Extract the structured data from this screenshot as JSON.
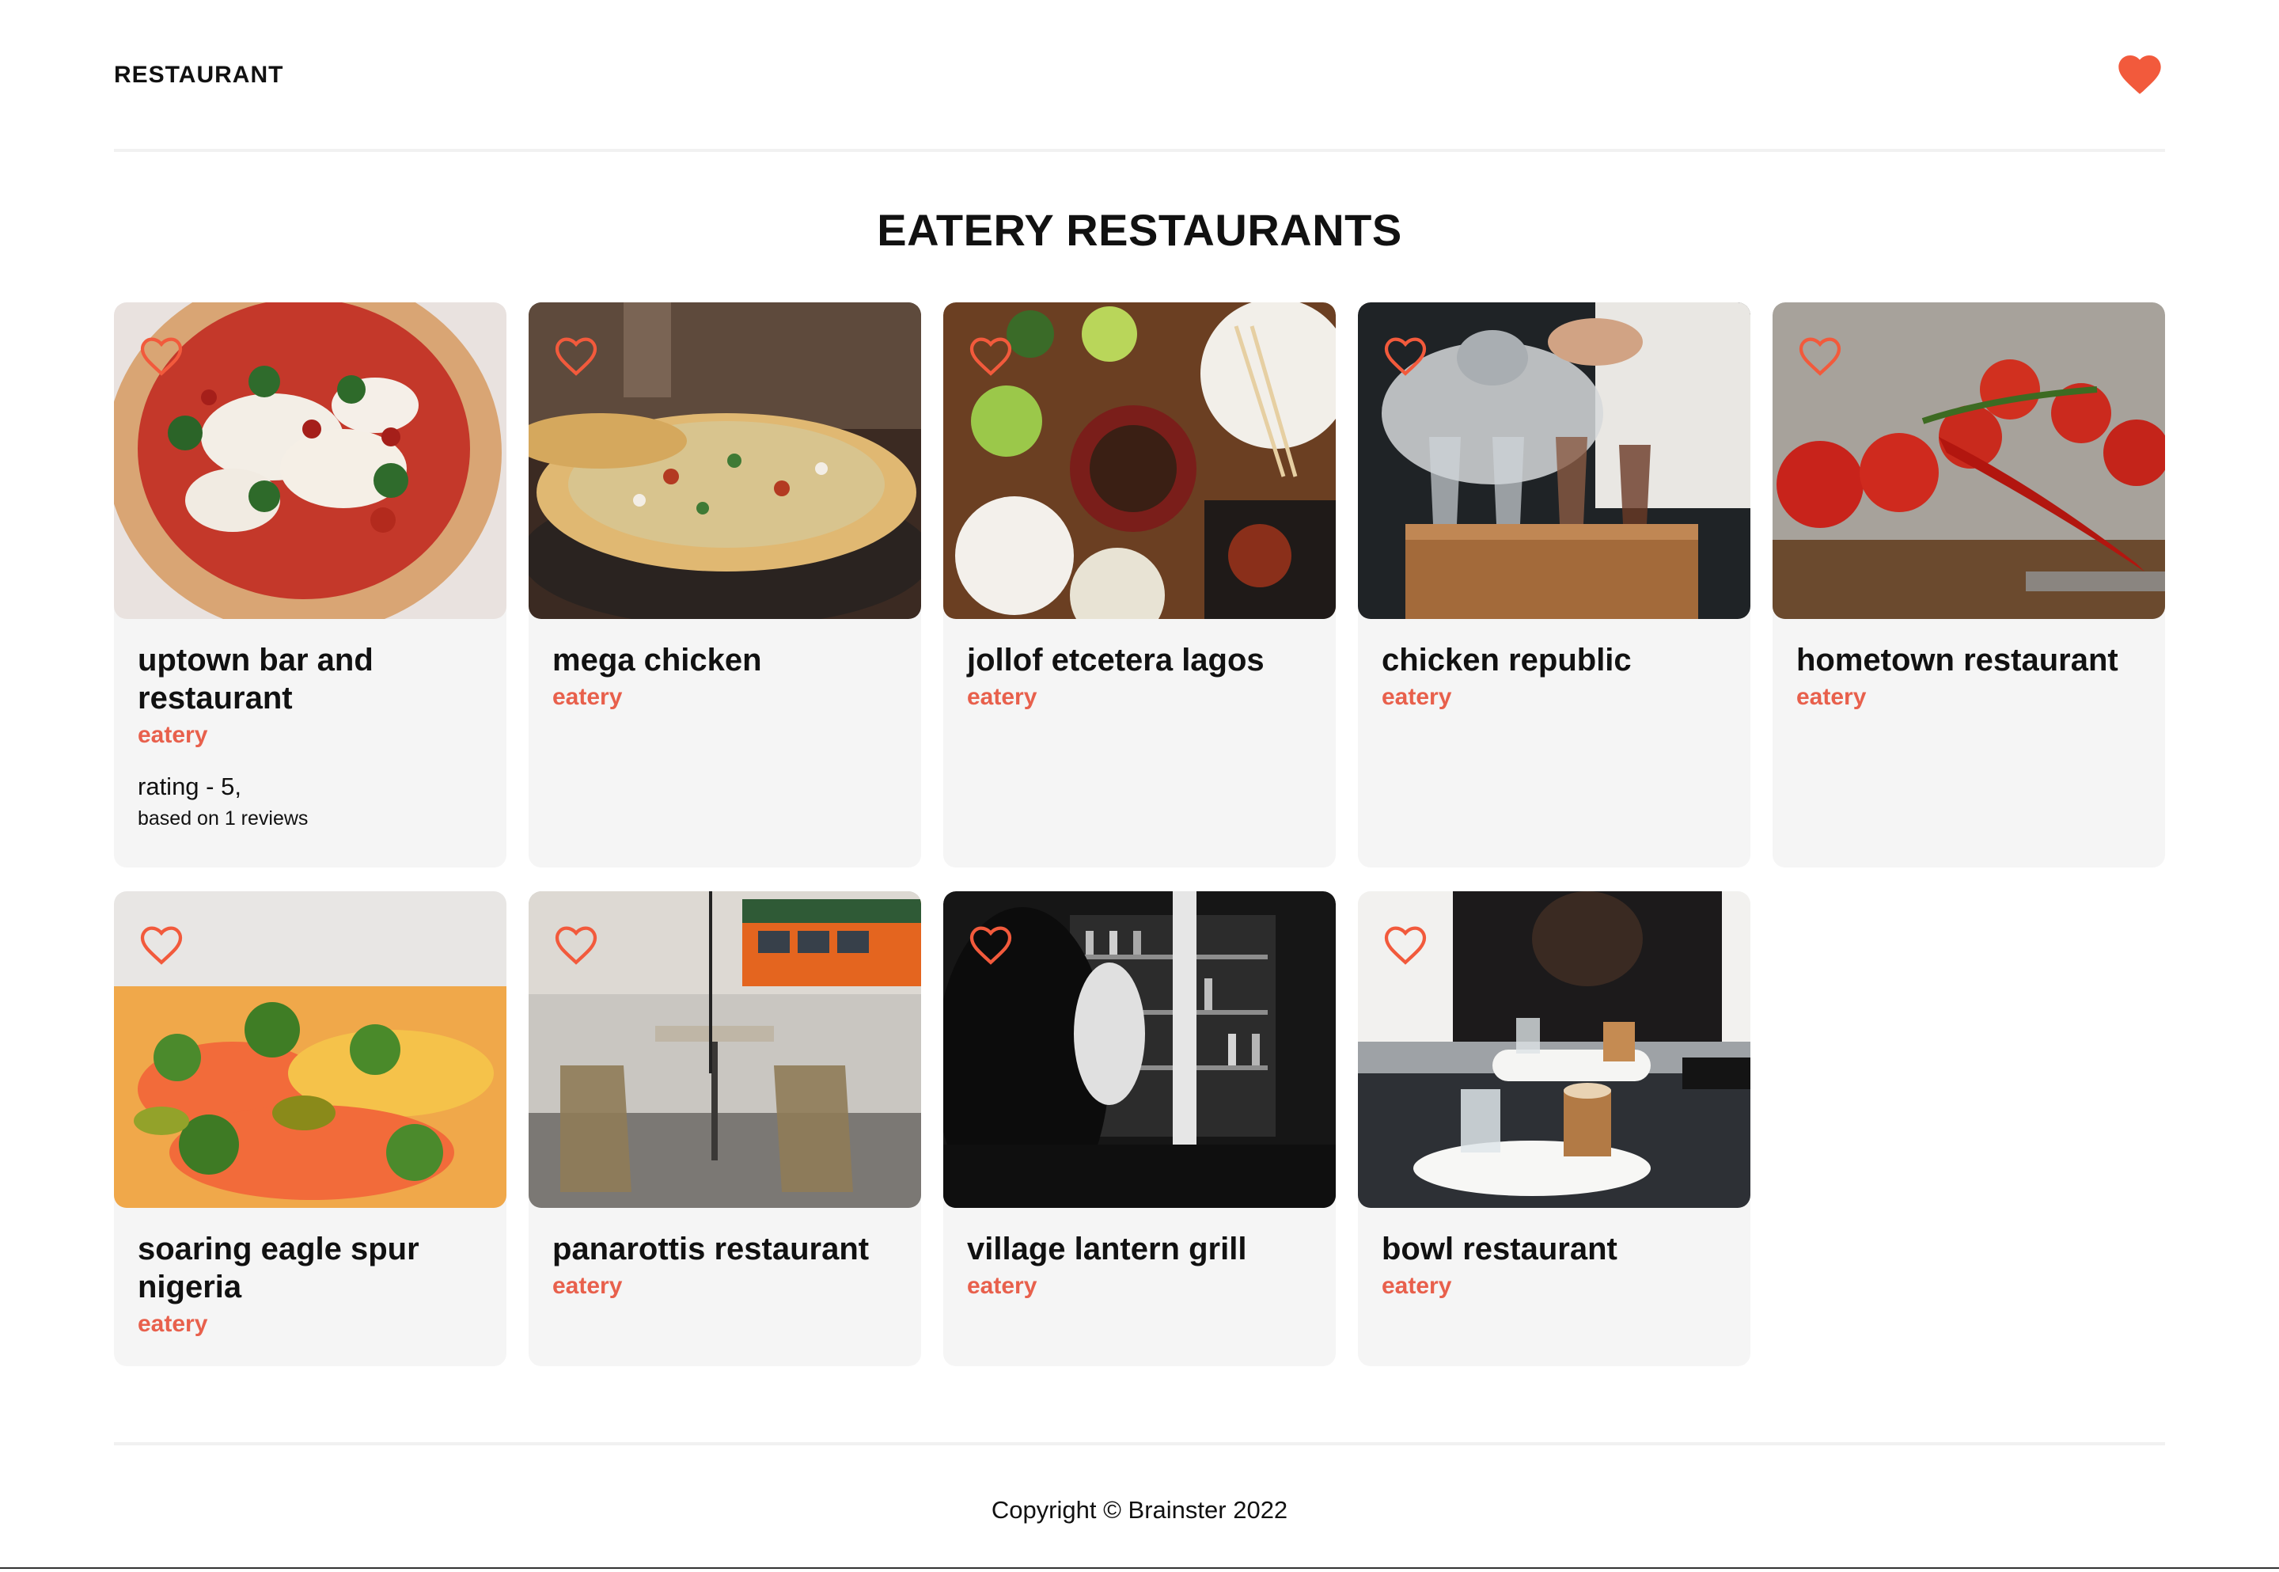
{
  "header": {
    "brand": "RESTAURANT",
    "favorites_icon": "heart-filled-icon"
  },
  "page": {
    "title": "EATERY RESTAURANTS"
  },
  "colors": {
    "accent": "#f25a3c",
    "category": "#e8604c",
    "card_bg": "#f5f5f5",
    "divider": "#f1f1f1"
  },
  "restaurants": [
    {
      "name": "uptown bar and restaurant",
      "category": "eatery",
      "rating": "rating - 5,",
      "reviews": "based on 1 reviews",
      "image": "pizza margherita photo",
      "heart_icon": "heart-outline-icon"
    },
    {
      "name": "mega chicken",
      "category": "eatery",
      "image": "pizza on counter photo",
      "heart_icon": "heart-outline-icon"
    },
    {
      "name": "jollof etcetera lagos",
      "category": "eatery",
      "image": "dishes on table with chopsticks photo",
      "heart_icon": "heart-outline-icon"
    },
    {
      "name": "chicken republic",
      "category": "eatery",
      "image": "pouring drinks with smoke photo",
      "heart_icon": "heart-outline-icon"
    },
    {
      "name": "hometown restaurant",
      "category": "eatery",
      "image": "tomatoes and chili pepper photo",
      "heart_icon": "heart-outline-icon"
    },
    {
      "name": "soaring eagle spur nigeria",
      "category": "eatery",
      "image": "vegetable pizza closeup photo",
      "heart_icon": "heart-outline-icon"
    },
    {
      "name": "panarottis restaurant",
      "category": "eatery",
      "image": "street cafe chairs and bus photo",
      "heart_icon": "heart-outline-icon"
    },
    {
      "name": "village lantern grill",
      "category": "eatery",
      "image": "black and white bar photo",
      "heart_icon": "heart-outline-icon"
    },
    {
      "name": "bowl restaurant",
      "category": "eatery",
      "image": "coffee cups on table photo",
      "heart_icon": "heart-outline-icon"
    }
  ],
  "footer": {
    "copyright": "Copyright © Brainster 2022"
  }
}
